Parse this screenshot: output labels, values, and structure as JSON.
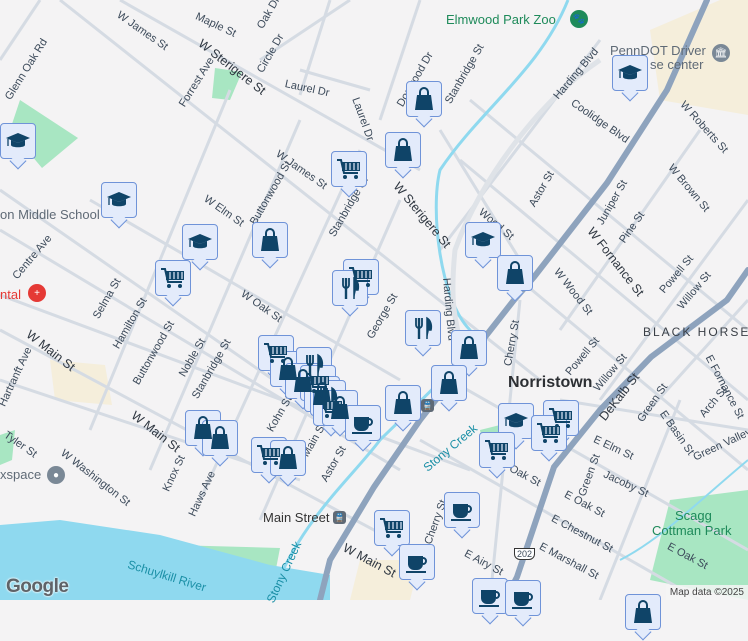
{
  "map": {
    "places": {
      "zoo": "Elmwood Park Zoo",
      "penndot_1": "PennDOT Driver",
      "penndot_2": "se center",
      "middle_school": "on Middle School",
      "hospital": "ntal",
      "workspace": "xspace",
      "main_street_station": "Main Street",
      "norristown": "Norristown",
      "black_horse": "BLACK HORSE",
      "scagg_park_1": "Scagg",
      "scagg_park_2": "Cottman Park",
      "schuylkill_river": "Schuylkill River",
      "stony_creek_1": "Stony Creek",
      "stony_creek_2": "Stony Creek",
      "route_202": "202"
    },
    "streets": [
      "W James St",
      "Maple St",
      "Oak Dr",
      "W Sterigere St",
      "Circle Dr",
      "Laurel Dr",
      "Forrest Ave",
      "Glenn Oak Rd",
      "W James St",
      "W Elm St",
      "Buttonwood St",
      "Stanbridge St",
      "Centre Ave",
      "W Oak St",
      "Selma St",
      "Hamilton St",
      "Buttonwood St",
      "Noble St",
      "W Main St",
      "Hartranft Ave",
      "W Main St",
      "Tyler St",
      "W Washington St",
      "Knox St",
      "Haws Ave",
      "Kohn St",
      "Astor St",
      "Main St",
      "George St",
      "Dogwood Dr",
      "Stanbridge St",
      "Laurel Dr",
      "W Sterigere St",
      "Harding Blvd",
      "Harding Blvd",
      "Coolidge Blvd",
      "W Roberts St",
      "Astor St",
      "Wood St",
      "W Brown St",
      "Juniper St",
      "W Fornance St",
      "Pine St",
      "Powell St",
      "W Wood St",
      "Willow St",
      "Cherry St",
      "Powell St",
      "Willow St",
      "DeKalb St",
      "E Fornance St",
      "Arch St",
      "Green St",
      "E Basin St",
      "Green Valley",
      "E Elm St",
      "Jacoby St",
      "Green St",
      "E Oak St",
      "E Chestnut St",
      "E Marshall St",
      "E Airy St",
      "E Oak St",
      "Cherry St",
      "W Main St",
      "Oak St",
      "Stanbridge St"
    ],
    "google_logo": "Google",
    "attribution": "Map data ©2025"
  },
  "markers": {
    "school": "school-marker",
    "cart": "grocery-marker",
    "bag": "shopping-marker",
    "fork": "restaurant-marker",
    "cup": "cafe-marker"
  },
  "colors": {
    "background": "#f4f3f4",
    "road": "#d5dbe3",
    "highway": "#8ea3bd",
    "water": "#8fd9ef",
    "park": "#a8e6c2",
    "marker_fill": "#e3ebfb",
    "marker_border": "#6f93d8",
    "icon": "#0f4468"
  }
}
